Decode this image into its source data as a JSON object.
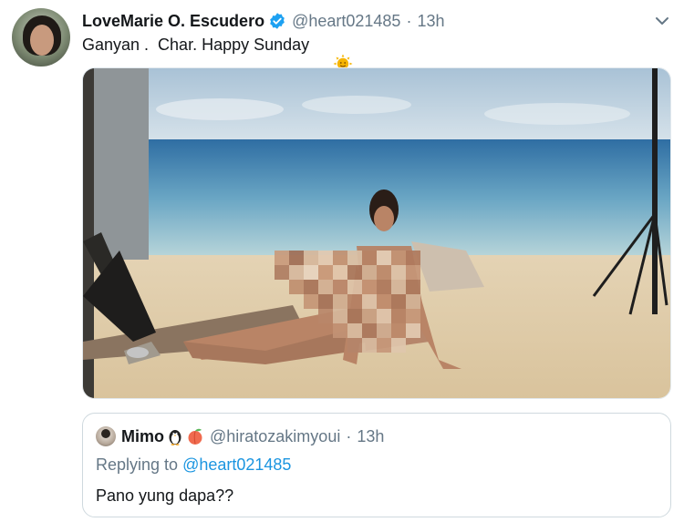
{
  "tweet": {
    "display_name": "LoveMarie O. Escudero",
    "handle": "@heart021485",
    "separator": "·",
    "time": "13h",
    "text": "Ganyan .  Char. Happy Sunday",
    "emoji": "sun-with-face-icon",
    "verified": true,
    "verified_color": "#1da1f2"
  },
  "quoted": {
    "display_name": "Mimo",
    "emojis": [
      "penguin-icon",
      "peach-icon"
    ],
    "handle": "@hiratozakimyoui",
    "separator": "·",
    "time": "13h",
    "replying_label": "Replying to",
    "replying_handle": "@heart021485",
    "text": "Pano yung dapa??"
  },
  "colors": {
    "text": "#14171a",
    "muted": "#657786",
    "link": "#1b95e0",
    "border": "#cfd9de"
  }
}
